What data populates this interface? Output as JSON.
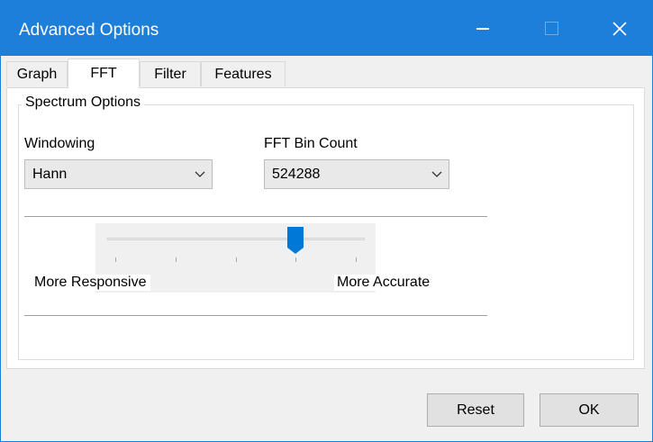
{
  "window": {
    "title": "Advanced Options",
    "accent": "#1e7fdb",
    "controls": [
      "minimize-icon",
      "maximize-icon",
      "close-icon"
    ]
  },
  "tabs": [
    {
      "label": "Graph",
      "active": false
    },
    {
      "label": "FFT",
      "active": true
    },
    {
      "label": "Filter",
      "active": false
    },
    {
      "label": "Features",
      "active": false
    }
  ],
  "spectrum": {
    "group_label": "Spectrum Options",
    "windowing_label": "Windowing",
    "windowing_value": "Hann",
    "bin_count_label": "FFT Bin Count",
    "bin_count_value": "524288",
    "slider": {
      "min_label": "More Responsive",
      "max_label": "More Accurate",
      "tick_count": 5,
      "position_index": 3,
      "thumb_color": "#0078d7"
    }
  },
  "buttons": {
    "reset": "Reset",
    "ok": "OK"
  }
}
